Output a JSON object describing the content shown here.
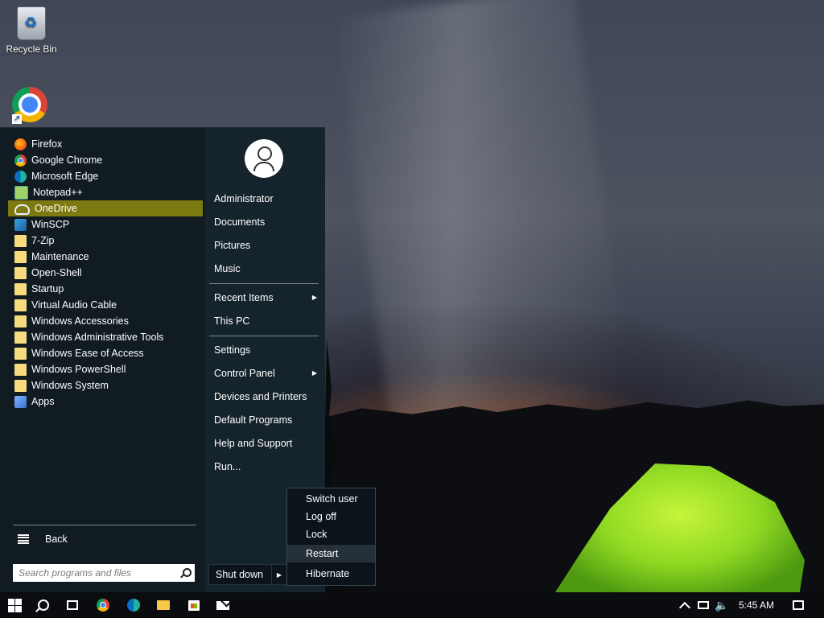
{
  "desktop": {
    "recycle_bin_label": "Recycle Bin"
  },
  "start_menu": {
    "programs": [
      {
        "label": "Firefox",
        "icon": "firefox-icon"
      },
      {
        "label": "Google Chrome",
        "icon": "chrome-icon"
      },
      {
        "label": "Microsoft Edge",
        "icon": "edge-icon"
      },
      {
        "label": "Notepad++",
        "icon": "notepadpp-icon"
      },
      {
        "label": "OneDrive",
        "icon": "onedrive-icon",
        "selected": true
      },
      {
        "label": "WinSCP",
        "icon": "winscp-icon"
      },
      {
        "label": "7-Zip",
        "icon": "folder-icon"
      },
      {
        "label": "Maintenance",
        "icon": "folder-icon"
      },
      {
        "label": "Open-Shell",
        "icon": "folder-icon"
      },
      {
        "label": "Startup",
        "icon": "folder-icon"
      },
      {
        "label": "Virtual Audio Cable",
        "icon": "folder-icon"
      },
      {
        "label": "Windows Accessories",
        "icon": "folder-icon"
      },
      {
        "label": "Windows Administrative Tools",
        "icon": "folder-icon"
      },
      {
        "label": "Windows Ease of Access",
        "icon": "folder-icon"
      },
      {
        "label": "Windows PowerShell",
        "icon": "folder-icon"
      },
      {
        "label": "Windows System",
        "icon": "folder-icon"
      },
      {
        "label": "Apps",
        "icon": "apps-icon"
      }
    ],
    "back_label": "Back",
    "search_placeholder": "Search programs and files",
    "right": {
      "user": "Administrator",
      "documents": "Documents",
      "pictures": "Pictures",
      "music": "Music",
      "recent_items": "Recent Items",
      "this_pc": "This PC",
      "settings": "Settings",
      "control_panel": "Control Panel",
      "devices_printers": "Devices and Printers",
      "default_programs": "Default Programs",
      "help_support": "Help and Support",
      "run": "Run..."
    },
    "shutdown_label": "Shut down",
    "power_menu": {
      "switch_user": "Switch user",
      "log_off": "Log off",
      "lock": "Lock",
      "restart": "Restart",
      "hibernate": "Hibernate"
    }
  },
  "taskbar": {
    "clock": "5:45 AM"
  },
  "colors": {
    "start_bg": "#101b22",
    "selected_bg": "#7d7a12",
    "taskbar_bg": "#0a0c0f"
  }
}
